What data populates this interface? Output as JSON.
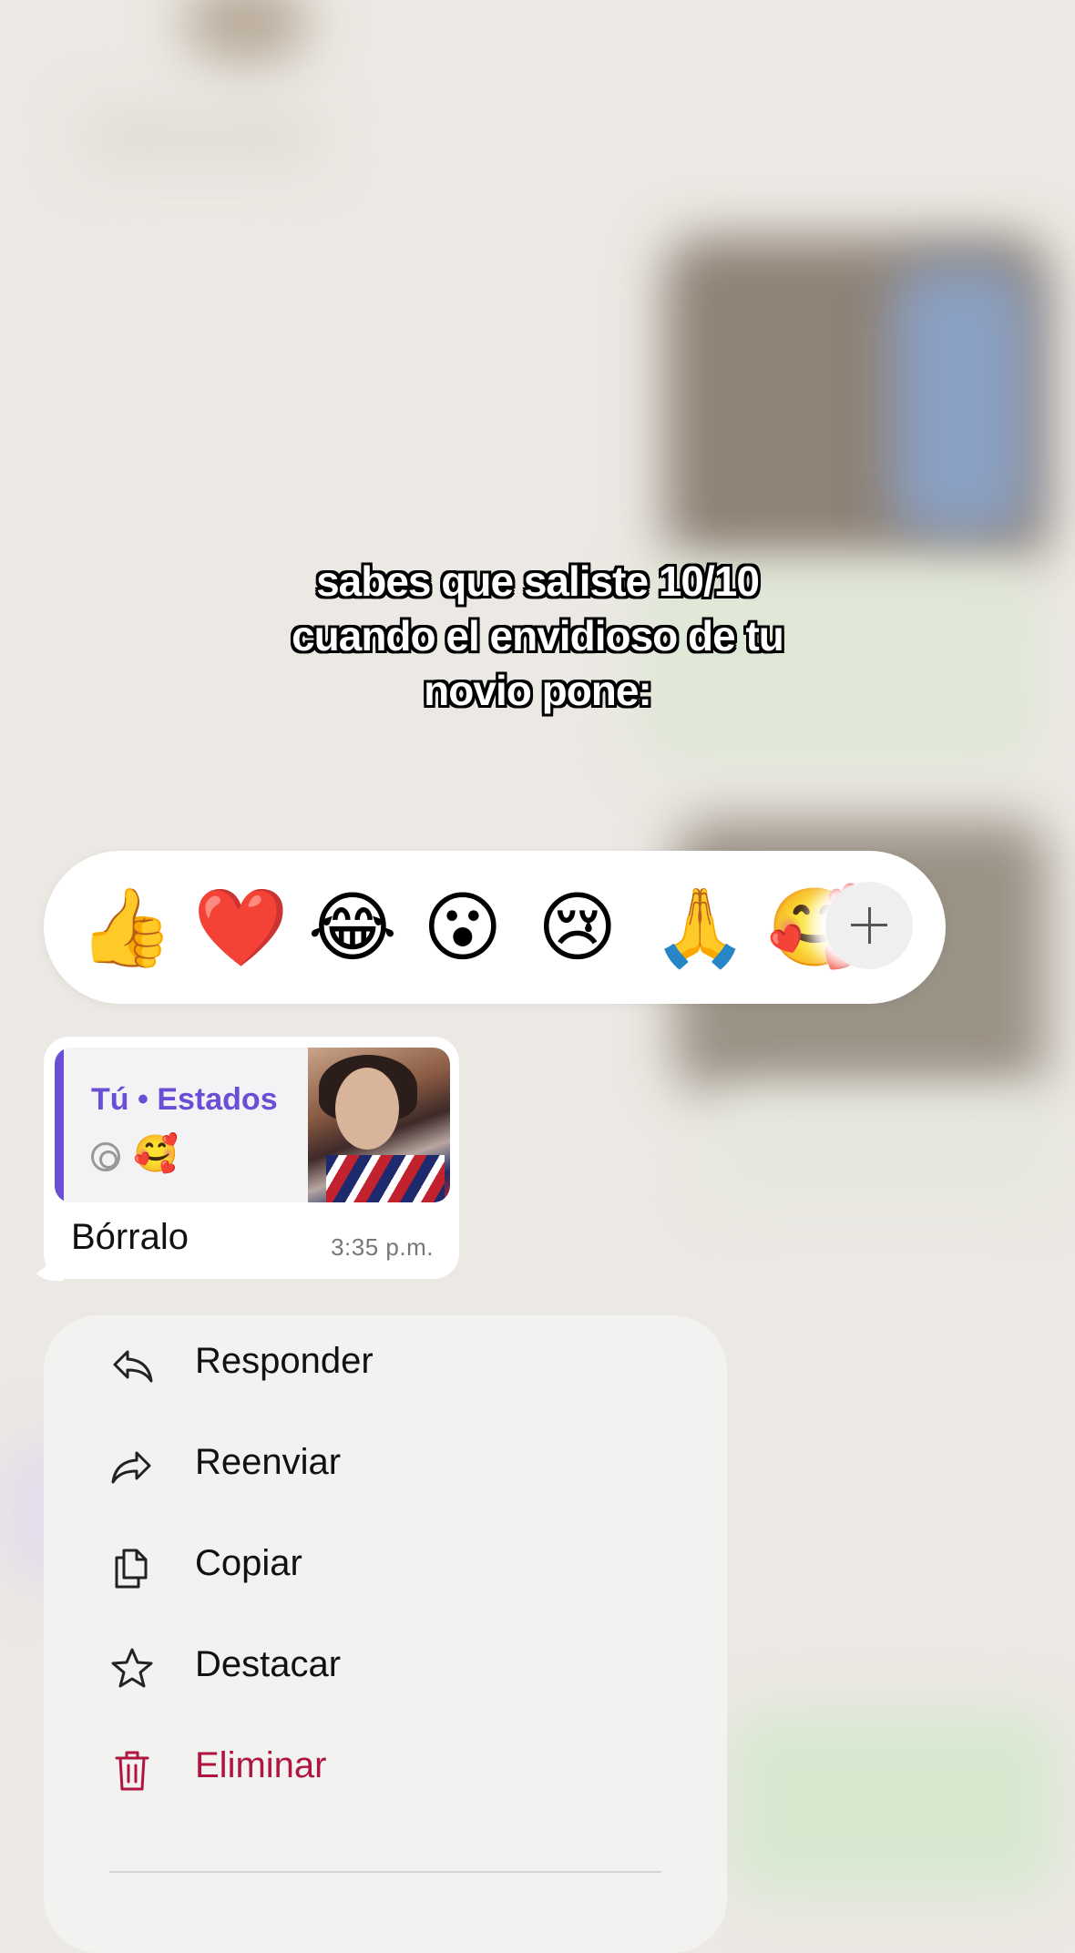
{
  "caption": {
    "lines": [
      "sabes que saliste 10/10",
      "cuando el envidioso de tu",
      "novio pone:"
    ]
  },
  "reactions": {
    "items": [
      {
        "emoji": "👍",
        "name": "thumbs-up"
      },
      {
        "emoji": "❤️",
        "name": "heart"
      },
      {
        "emoji": "😂",
        "name": "tears-of-joy"
      },
      {
        "emoji": "😮",
        "name": "surprised"
      },
      {
        "emoji": "😢",
        "name": "crying"
      },
      {
        "emoji": "🙏",
        "name": "praying-hands"
      },
      {
        "emoji": "🥰",
        "name": "smiling-hearts"
      }
    ],
    "more_icon": "plus-icon"
  },
  "message": {
    "quote_title": "Tú • Estados",
    "quote_emoji": "🥰",
    "text": "Bórralo",
    "time": "3:35 p.m."
  },
  "menu": {
    "items": [
      {
        "label": "Responder",
        "icon": "reply-icon"
      },
      {
        "label": "Reenviar",
        "icon": "forward-icon"
      },
      {
        "label": "Copiar",
        "icon": "copy-icon"
      },
      {
        "label": "Destacar",
        "icon": "star-icon"
      },
      {
        "label": "Eliminar",
        "icon": "trash-icon",
        "color": "#b0153f"
      }
    ]
  }
}
